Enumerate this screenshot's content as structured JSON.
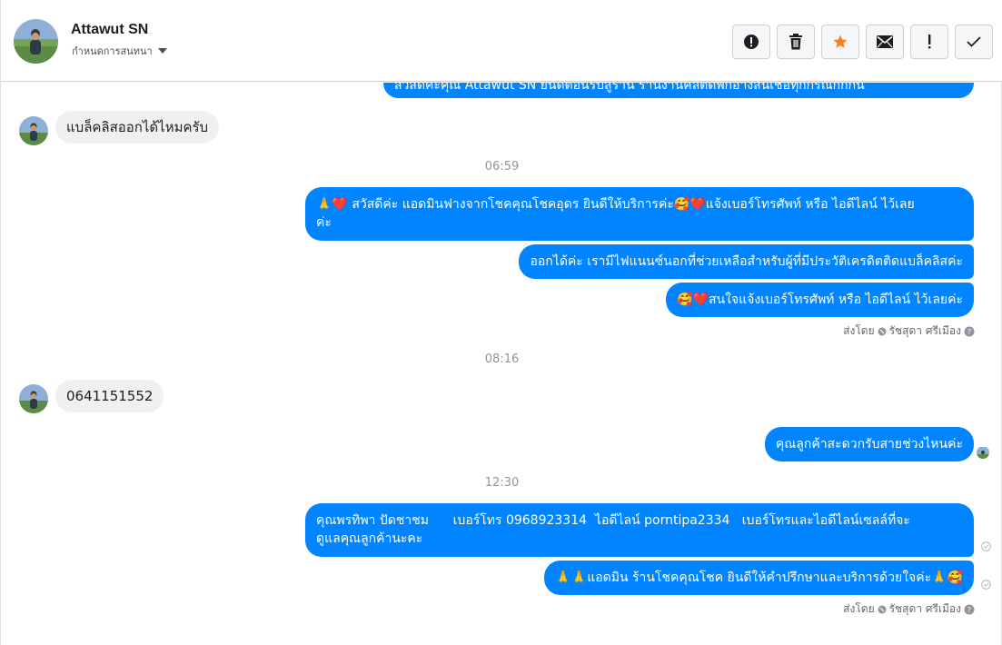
{
  "header": {
    "contact_name": "Attawut SN",
    "assign_label": "กำหนดการสนทนา",
    "toolbar": [
      "alert-circle-icon",
      "trash-icon",
      "star-icon",
      "mail-icon",
      "exclamation-icon",
      "check-icon"
    ],
    "star_color": "#f5821f"
  },
  "thread": {
    "top_partial": "สวัสดีค่ะคุณ Attawut SN ยินดีต้อนรับสู่ร้าน ร้านงานคิลติดพักอ้างสินเชื่อทุกกรณีกักกัน",
    "in_1": "แบล็คลิสออกได้ไหมครับ",
    "time_1": "06:59",
    "out_1a": "🙏❤️ สวัสดีค่ะ แอดมินฟางจากโชคคุณโชคอุดร ยินดีให้บริการค่ะ🥰❤️แจ้งเบอร์โทรศัพท์ หรือ ไอดีไลน์  ไว้เลย",
    "out_1b": "ค่ะ",
    "out_2": "ออกได้ค่ะ เรามีไฟแนนซ์นอกที่ช่วยเหลือสำหรับผู้ที่มีประวัติเครดิตติดแบล็คลิสค่ะ",
    "out_3": "🥰❤️สนใจแจ้งเบอร์โทรศัพท์ หรือ ไอดีไลน์  ไว้เลยค่ะ",
    "sent_by_label": "ส่งโดย",
    "sent_by_name": "รัชสุดา ศรีเมือง",
    "time_2": "08:16",
    "in_2": "0641151552",
    "out_4": "คุณลูกค้าสะดวกรับสายช่วงไหนค่ะ",
    "time_3": "12:30",
    "out_5a": "คุณพรทิพา ปัดชาชม      เบอร์โทร 0968923314  ไอดีไลน์ porntipa2334   เบอร์โทรและไอดีไลน์เซลล์ที่จะ",
    "out_5b": "ดูแลคุณลูกค้านะคะ",
    "out_6": "🙏🙏แอดมิน ร้านโชคคุณโชค ยินดีให้คำปรึกษาและบริการด้วยใจค่ะ🙏🥰",
    "sent_by_label_2": "ส่งโดย",
    "sent_by_name_2": "รัชสุดา ศรีเมือง",
    "bubble_color": "#0084ff"
  }
}
